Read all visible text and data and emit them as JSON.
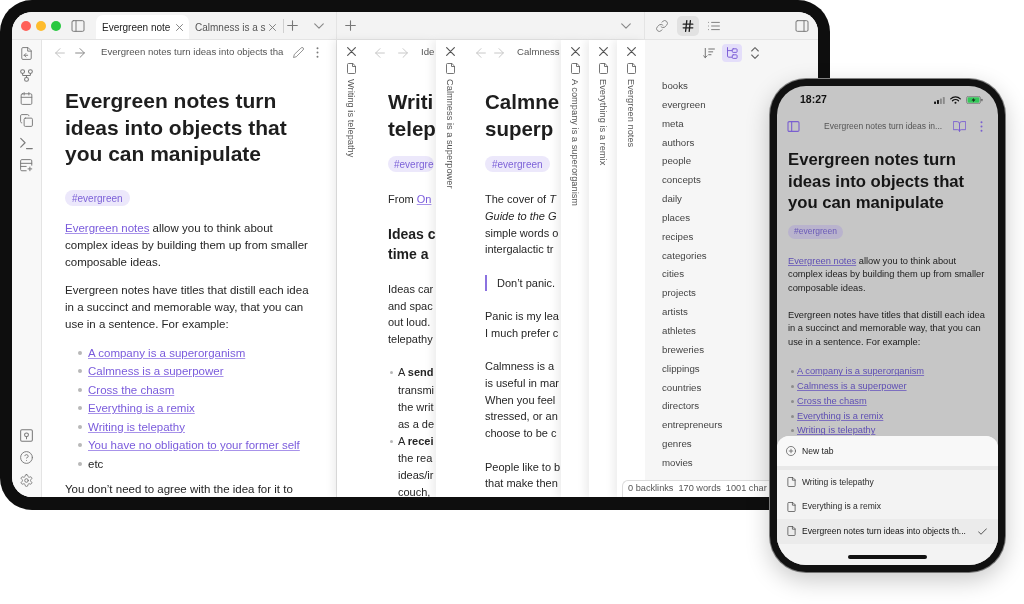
{
  "tablet": {
    "tabs": [
      {
        "label": "Evergreen note",
        "selected": true
      },
      {
        "label": "Calmness is a s",
        "selected": false
      }
    ],
    "sidebar_tabs": [
      {
        "kind": "links",
        "selected": false
      },
      {
        "kind": "tags",
        "selected": true
      },
      {
        "kind": "outline",
        "selected": false
      }
    ],
    "main_pane": {
      "header_title": "Evergreen notes turn ideas into objects tha",
      "title": "Evergreen notes turn ideas into objects that you can manipulate",
      "tag": "#evergreen",
      "blocks": [
        {
          "kind": "paragraph",
          "segments": [
            {
              "text": "Evergreen notes",
              "link": true
            },
            {
              "text": " allow you to think about complex ideas by building them up from smaller composable ideas.",
              "link": false
            }
          ]
        },
        {
          "kind": "paragraph",
          "segments": [
            {
              "text": "Evergreen notes have titles that distill each idea in a succinct and memorable way, that you can use in a sentence. For example:",
              "link": false
            }
          ]
        },
        {
          "kind": "list",
          "items": [
            {
              "text": "A company is a superorganism",
              "link": true
            },
            {
              "text": "Calmness is a superpower",
              "link": true
            },
            {
              "text": "Cross the chasm",
              "link": true
            },
            {
              "text": "Everything is a remix",
              "link": true
            },
            {
              "text": "Writing is telepathy",
              "link": true
            },
            {
              "text": "You have no obligation to your former self",
              "link": true
            },
            {
              "text": "etc",
              "link": false
            }
          ]
        },
        {
          "kind": "paragraph",
          "segments": [
            {
              "text": "You don’t need to agree with the idea for it to",
              "link": false
            }
          ]
        }
      ]
    },
    "stacked_panes": [
      {
        "spine_title": "Writing is telepathy",
        "header_title": "Ide",
        "title_lines": [
          "Writi",
          "telep"
        ],
        "tag": "#evergre",
        "blocks": [
          {
            "kind": "source",
            "text": "From",
            "link": "On"
          },
          {
            "kind": "heading",
            "lines": [
              "Ideas c",
              "time a"
            ]
          },
          {
            "kind": "paragraph",
            "lines": [
              "Ideas car",
              "and spac",
              "out loud.",
              "telepathy"
            ]
          },
          {
            "kind": "bullets",
            "items": [
              [
                "A **send**",
                "transmi",
                "the writ",
                "as a de"
              ],
              [
                "A **recei**",
                "the rea",
                "ideas/ir",
                "couch,"
              ]
            ]
          }
        ]
      },
      {
        "spine_title": "Calmness is a superpower",
        "header_title": "Calmness",
        "title_lines": [
          "Calmne",
          "superp"
        ],
        "tag": "#evergreen",
        "blocks": [
          {
            "kind": "paragraph",
            "lines": [
              "The cover of *T*",
              "*Guide to the G*",
              "simple words o",
              "intergalactic tr"
            ]
          },
          {
            "kind": "quote",
            "lines": [
              "Don’t panic."
            ]
          },
          {
            "kind": "paragraph",
            "lines": [
              "Panic is my lea",
              "I much prefer c"
            ]
          },
          {
            "kind": "paragraph",
            "lines": [
              "Calmness is a",
              "is useful in mar",
              "When you feel",
              "stressed, or an",
              "choose to be c"
            ]
          },
          {
            "kind": "paragraph",
            "lines": [
              "People like to b",
              "that make then"
            ]
          }
        ]
      }
    ],
    "collapsed_panes": [
      "A company is a superorganism",
      "Everything is a remix",
      "Evergreen notes"
    ],
    "tag_pane": {
      "tools": [
        {
          "kind": "sort",
          "selected": false
        },
        {
          "kind": "nested",
          "selected": true
        },
        {
          "kind": "collapse",
          "selected": false
        }
      ],
      "tags": [
        "books",
        "evergreen",
        "meta",
        "authors",
        "people",
        "concepts",
        "daily",
        "places",
        "recipes",
        "categories",
        "cities",
        "projects",
        "artists",
        "athletes",
        "breweries",
        "clippings",
        "countries",
        "directors",
        "entrepreneurs",
        "genres",
        "movies"
      ]
    },
    "status_bar": [
      "0 backlinks",
      "170 words",
      "1001 char"
    ]
  },
  "phone": {
    "time": "18:27",
    "header_title": "Evergreen notes turn ideas in...",
    "note": {
      "title": "Evergreen notes turn ideas into objects that you can manipulate",
      "tag": "#evergreen",
      "blocks": [
        {
          "kind": "paragraph",
          "segments": [
            {
              "text": "Evergreen notes",
              "link": true
            },
            {
              "text": " allow you to think about complex ideas by building them up from smaller composable ideas.",
              "link": false
            }
          ]
        },
        {
          "kind": "paragraph",
          "segments": [
            {
              "text": "Evergreen notes have titles that distill each idea in a succinct and memorable way, that you can use in a sentence. For example:",
              "link": false
            }
          ]
        },
        {
          "kind": "list",
          "items": [
            {
              "text": "A company is a superorganism",
              "link": true
            },
            {
              "text": "Calmness is a superpower",
              "link": true
            },
            {
              "text": "Cross the chasm",
              "link": true
            },
            {
              "text": "Everything is a remix",
              "link": true
            },
            {
              "text": "Writing is telepathy",
              "link": true
            }
          ]
        }
      ]
    },
    "tab_menu": {
      "new_tab": "New tab",
      "tabs": [
        {
          "label": "Writing is telepathy",
          "selected": false
        },
        {
          "label": "Everything is a remix",
          "selected": false
        },
        {
          "label": "Evergreen notes turn ideas into objects th...",
          "selected": true
        }
      ]
    }
  }
}
